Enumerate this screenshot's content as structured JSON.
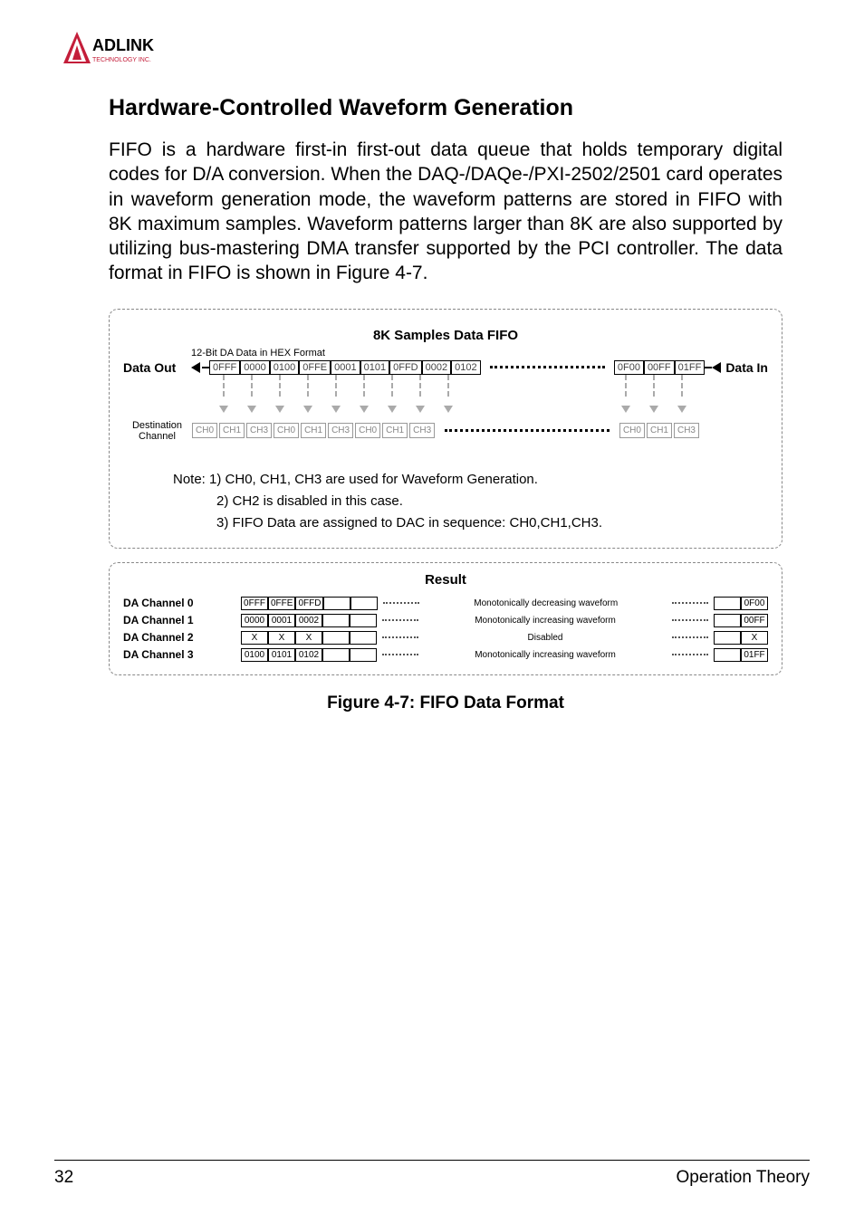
{
  "logo": {
    "brand": "ADLINK",
    "sub": "TECHNOLOGY INC."
  },
  "section_title": "Hardware-Controlled Waveform Generation",
  "body_text": "FIFO is a hardware first-in first-out data queue that holds temporary digital codes for D/A conversion. When the DAQ-/DAQe-/PXI-2502/2501 card operates in waveform generation mode, the waveform patterns are stored in FIFO with 8K maximum samples. Waveform patterns larger than 8K are also supported by utilizing bus-mastering DMA transfer supported by the PCI controller. The data format in FIFO is shown in Figure 4-7.",
  "fifo": {
    "title": "8K Samples Data FIFO",
    "hex_note": "12-Bit DA Data in HEX Format",
    "data_out": "Data Out",
    "data_in": "Data In",
    "dest_label": "Destination\nChannel",
    "left_cells": [
      "0FFF",
      "0000",
      "0100",
      "0FFE",
      "0001",
      "0101",
      "0FFD",
      "0002",
      "0102"
    ],
    "right_cells": [
      "0F00",
      "00FF",
      "01FF"
    ],
    "left_ch": [
      "CH0",
      "CH1",
      "CH3",
      "CH0",
      "CH1",
      "CH3",
      "CH0",
      "CH1",
      "CH3"
    ],
    "right_ch": [
      "CH0",
      "CH1",
      "CH3"
    ],
    "notes": [
      "Note: 1) CH0, CH1, CH3 are used for Waveform Generation.",
      "2) CH2 is disabled in this case.",
      "3) FIFO Data are assigned to DAC in sequence: CH0,CH1,CH3."
    ]
  },
  "result": {
    "title": "Result",
    "rows": [
      {
        "label": "DA Channel  0",
        "cells": [
          "0FFF",
          "0FFE",
          "0FFD"
        ],
        "desc": "Monotonically decreasing waveform",
        "end": "0F00"
      },
      {
        "label": "DA Channel  1",
        "cells": [
          "0000",
          "0001",
          "0002"
        ],
        "desc": "Monotonically increasing waveform",
        "end": "00FF"
      },
      {
        "label": "DA Channel  2",
        "cells": [
          "X",
          "X",
          "X"
        ],
        "desc": "Disabled",
        "end": "X"
      },
      {
        "label": "DA Channel  3",
        "cells": [
          "0100",
          "0101",
          "0102"
        ],
        "desc": "Monotonically increasing waveform",
        "end": "01FF"
      }
    ]
  },
  "figure_caption": "Figure 4-7: FIFO Data Format",
  "footer": {
    "page": "32",
    "section": "Operation Theory"
  }
}
